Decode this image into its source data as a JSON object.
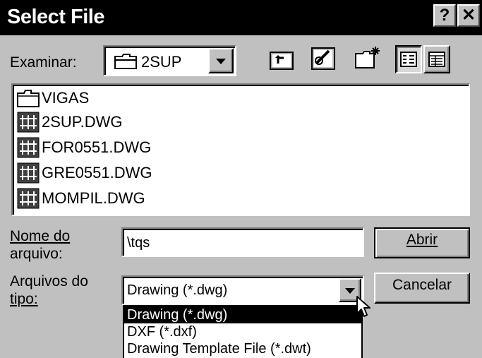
{
  "window": {
    "title": "Select File",
    "help_glyph": "?",
    "close_glyph": "✕"
  },
  "lookin": {
    "label": "Examinar:",
    "current_folder": "2SUP"
  },
  "toolbar": {
    "icons": [
      "up-one-level-icon",
      "favorites-icon",
      "create-new-folder-icon",
      "list-view-icon",
      "details-view-icon"
    ]
  },
  "files": [
    {
      "name": "VIGAS",
      "icon": "folder-icon"
    },
    {
      "name": "2SUP.DWG",
      "icon": "dwg-file-icon"
    },
    {
      "name": "FOR0551.DWG",
      "icon": "dwg-file-icon"
    },
    {
      "name": "GRE0551.DWG",
      "icon": "dwg-file-icon"
    },
    {
      "name": "MOMPIL.DWG",
      "icon": "dwg-file-icon"
    }
  ],
  "filename": {
    "label_line1": "Nome do",
    "label_line2": "arquivo:",
    "value": "\\tqs"
  },
  "filetype": {
    "label_line1": "Arquivos do",
    "label_line2": "tipo:",
    "selected": "Drawing (*.dwg)",
    "options": [
      "Drawing (*.dwg)",
      "DXF (*.dxf)",
      "Drawing Template File (*.dwt)"
    ]
  },
  "buttons": {
    "open": "Abrir",
    "cancel": "Cancelar"
  }
}
